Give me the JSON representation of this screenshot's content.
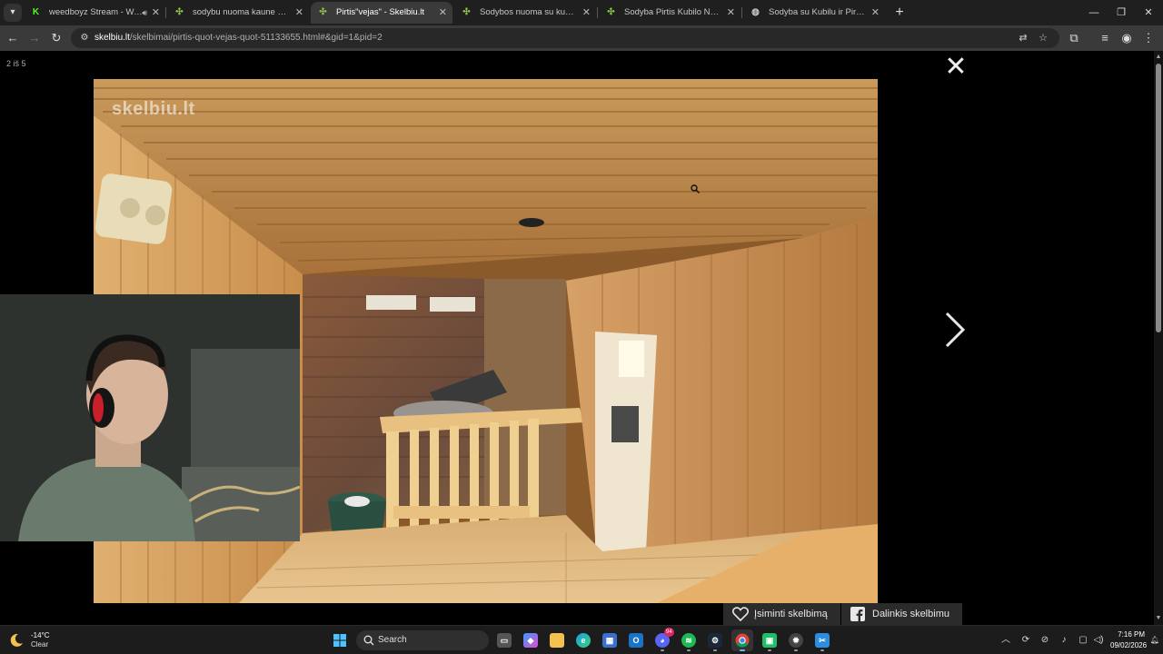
{
  "browser": {
    "tabs": [
      {
        "title": "weedboyz Stream - Watch",
        "favicon": "kick-icon",
        "color": "#53fc18",
        "muted_audio": true
      },
      {
        "title": "sodybu nuoma kaune skelbimai",
        "favicon": "skelbiu-icon",
        "color": "#8bc34a"
      },
      {
        "title": "Pirtis\"vejas\" - Skelbiu.lt",
        "favicon": "skelbiu-icon",
        "color": "#8bc34a",
        "active": true
      },
      {
        "title": "Sodybos nuoma su kubilu,džiak",
        "favicon": "skelbiu-icon",
        "color": "#8bc34a"
      },
      {
        "title": "Sodyba Pirtis Kubilo Nuoma so",
        "favicon": "skelbiu-icon",
        "color": "#8bc34a"
      },
      {
        "title": "Sodyba su Kubilu ir Pirtimi - Nu",
        "favicon": "globe-icon",
        "color": "#cccccc"
      }
    ],
    "url_host": "skelbiu.lt",
    "url_path": "/skelbimai/pirtis-quot-vejas-quot-51133655.html#&gid=1&pid=2"
  },
  "gallery": {
    "counter": "2 iš 5",
    "watermark": "skelbiu.lt",
    "save_label": "Įsiminti skelbimą",
    "share_label": "Dalinkis skelbimu"
  },
  "taskbar": {
    "weather_temp": "-14°C",
    "weather_cond": "Clear",
    "search_label": "Search",
    "time": "7:16 PM",
    "date": "09/02/2026",
    "discord_badge": "94",
    "apps": [
      "windows-start",
      "search",
      "task-view",
      "copilot",
      "file-explorer",
      "edge",
      "store",
      "outlook",
      "discord",
      "spotify",
      "steam",
      "chrome",
      "app-green",
      "settings",
      "snipping-tool"
    ]
  },
  "colors": {
    "accent": "#6cb2ff",
    "kick_green": "#53fc18",
    "skelbiu_green": "#8bc34a"
  }
}
